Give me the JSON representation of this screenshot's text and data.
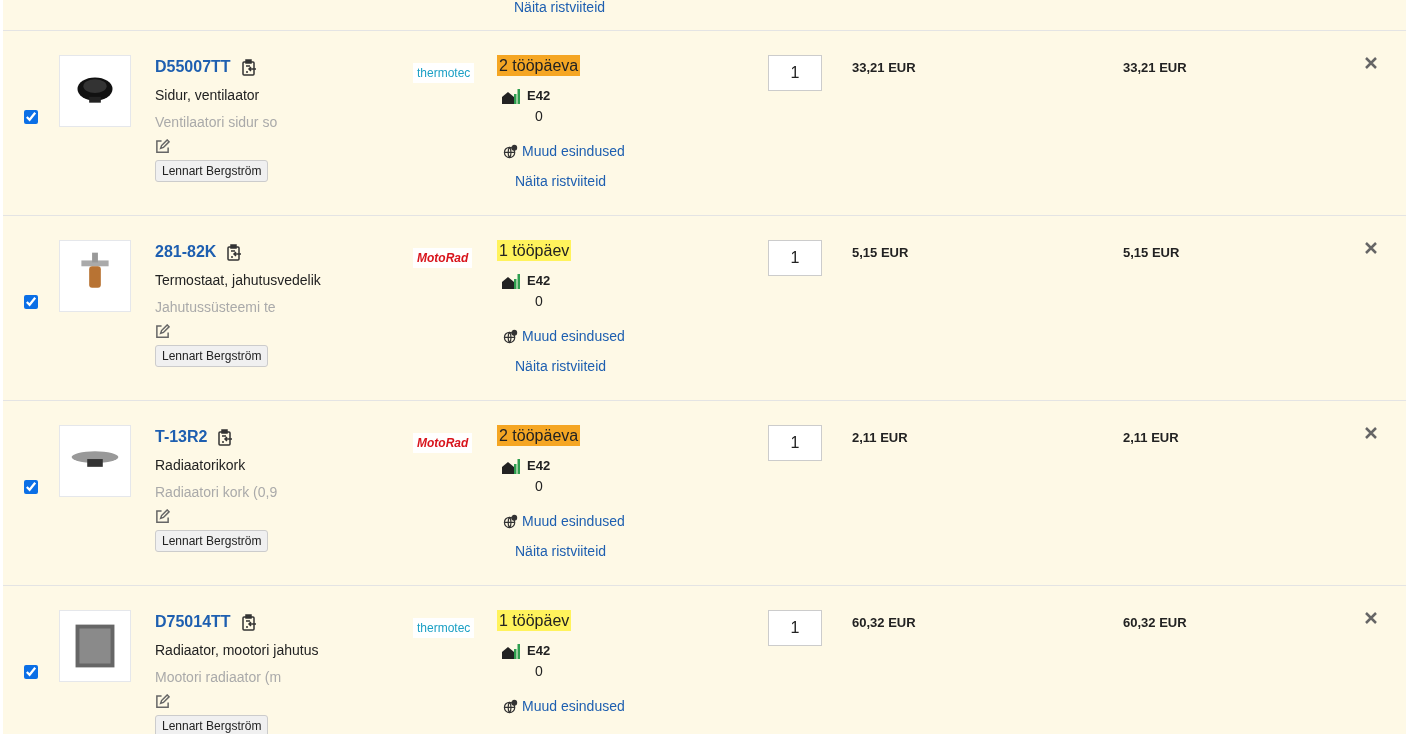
{
  "top_row": {
    "cross_reference_link": "Näita ristviiteid"
  },
  "rows": [
    {
      "checked": true,
      "code": "D55007TT",
      "name": "Sidur, ventilaator",
      "description": "Ventilaatori sidur so",
      "tag": "Lennart Bergström",
      "brand": {
        "kind": "thermotec",
        "text": "thermotec"
      },
      "delivery": {
        "text": "2 tööpäeva",
        "color": "#f5a623"
      },
      "warehouse": "E42",
      "stock": "0",
      "other_branches_link": "Muud esindused",
      "cross_reference_link": "Näita ristviiteid",
      "quantity": "1",
      "price": "33,21 EUR",
      "total": "33,21 EUR"
    },
    {
      "checked": true,
      "code": "281-82K",
      "name": "Termostaat, jahutusvedelik",
      "description": "Jahutussüsteemi te",
      "tag": "Lennart Bergström",
      "brand": {
        "kind": "motorad",
        "text": "MotoRad"
      },
      "delivery": {
        "text": "1 tööpäev",
        "color": "#fff35c"
      },
      "warehouse": "E42",
      "stock": "0",
      "other_branches_link": "Muud esindused",
      "cross_reference_link": "Näita ristviiteid",
      "quantity": "1",
      "price": "5,15 EUR",
      "total": "5,15 EUR"
    },
    {
      "checked": true,
      "code": "T-13R2",
      "name": "Radiaatorikork",
      "description": "Radiaatori kork (0,9",
      "tag": "Lennart Bergström",
      "brand": {
        "kind": "motorad",
        "text": "MotoRad"
      },
      "delivery": {
        "text": "2 tööpäeva",
        "color": "#f5a623"
      },
      "warehouse": "E42",
      "stock": "0",
      "other_branches_link": "Muud esindused",
      "cross_reference_link": "Näita ristviiteid",
      "quantity": "1",
      "price": "2,11 EUR",
      "total": "2,11 EUR"
    },
    {
      "checked": true,
      "code": "D75014TT",
      "name": "Radiaator, mootori jahutus",
      "description": "Mootori radiaator (m",
      "tag": "Lennart Bergström",
      "brand": {
        "kind": "thermotec",
        "text": "thermotec"
      },
      "delivery": {
        "text": "1 tööpäev",
        "color": "#fff35c"
      },
      "warehouse": "E42",
      "stock": "0",
      "other_branches_link": "Muud esindused",
      "quantity": "1",
      "price": "60,32 EUR",
      "total": "60,32 EUR"
    }
  ]
}
